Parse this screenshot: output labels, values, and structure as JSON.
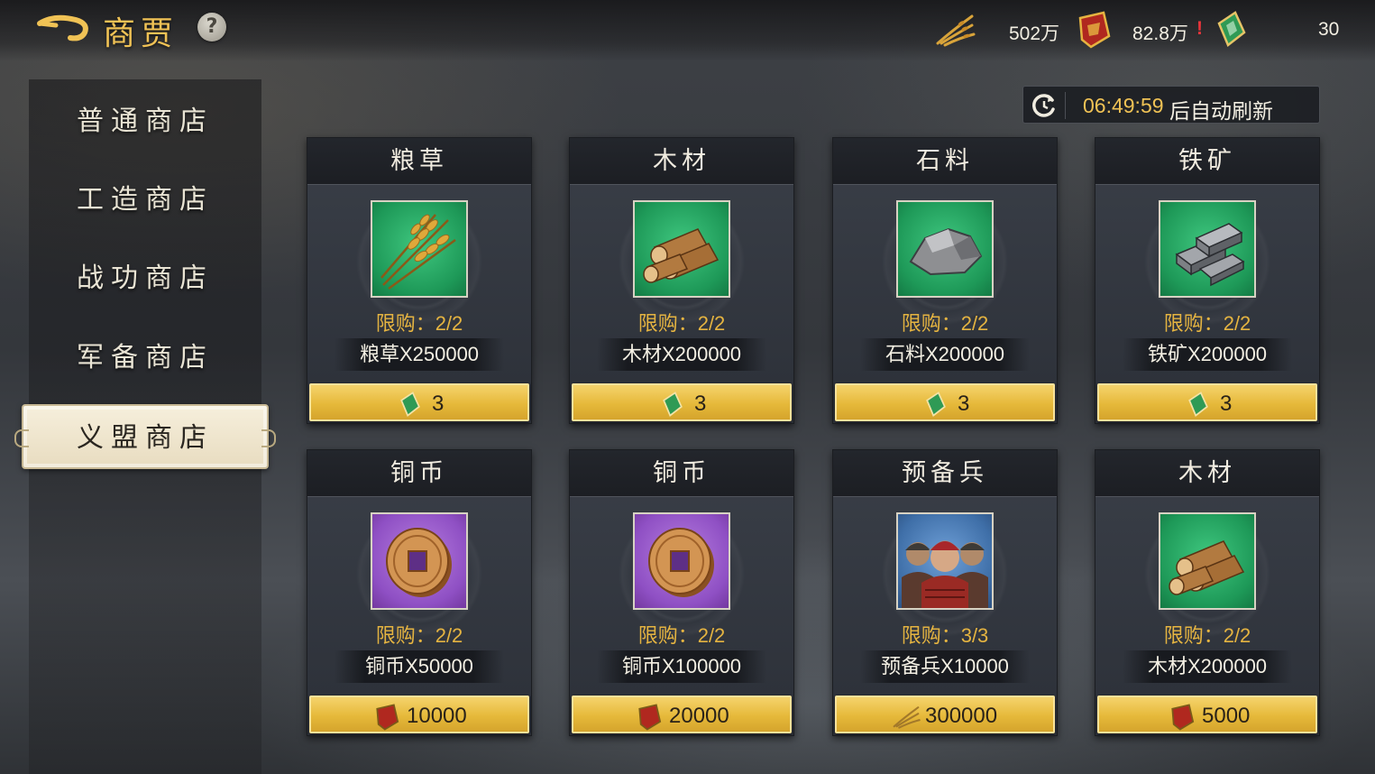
{
  "header": {
    "title": "商贾",
    "help_label": "?"
  },
  "resources": [
    {
      "name": "grain",
      "icon": "grain-icon",
      "value": "502万"
    },
    {
      "name": "merit",
      "icon": "merit-token-icon",
      "value": "82.8万",
      "warning": "!"
    },
    {
      "name": "alliance-token",
      "icon": "alliance-token-icon",
      "value": "30"
    }
  ],
  "refresh": {
    "time": "06:49:59",
    "suffix": "后自动刷新"
  },
  "sidebar": {
    "items": [
      {
        "label": "普通商店",
        "active": false
      },
      {
        "label": "工造商店",
        "active": false
      },
      {
        "label": "战功商店",
        "active": false
      },
      {
        "label": "军备商店",
        "active": false
      },
      {
        "label": "义盟商店",
        "active": true
      }
    ]
  },
  "cards": [
    {
      "title": "粮草",
      "icon": "grain-bundle-icon",
      "rarity": "green",
      "limit": "限购：2/2",
      "amount": "粮草X250000",
      "currency_icon": "alliance-token-icon",
      "price": "3"
    },
    {
      "title": "木材",
      "icon": "wood-logs-icon",
      "rarity": "green",
      "limit": "限购：2/2",
      "amount": "木材X200000",
      "currency_icon": "alliance-token-icon",
      "price": "3"
    },
    {
      "title": "石料",
      "icon": "stone-icon",
      "rarity": "green",
      "limit": "限购：2/2",
      "amount": "石料X200000",
      "currency_icon": "alliance-token-icon",
      "price": "3"
    },
    {
      "title": "铁矿",
      "icon": "iron-ingots-icon",
      "rarity": "green",
      "limit": "限购：2/2",
      "amount": "铁矿X200000",
      "currency_icon": "alliance-token-icon",
      "price": "3"
    },
    {
      "title": "铜币",
      "icon": "copper-coin-icon",
      "rarity": "purple",
      "limit": "限购：2/2",
      "amount": "铜币X50000",
      "currency_icon": "merit-token-icon",
      "price": "10000"
    },
    {
      "title": "铜币",
      "icon": "copper-coin-icon",
      "rarity": "purple",
      "limit": "限购：2/2",
      "amount": "铜币X100000",
      "currency_icon": "merit-token-icon",
      "price": "20000"
    },
    {
      "title": "预备兵",
      "icon": "reserve-soldiers-icon",
      "rarity": "blue",
      "limit": "限购：3/3",
      "amount": "预备兵X10000",
      "currency_icon": "grain-icon",
      "price": "300000"
    },
    {
      "title": "木材",
      "icon": "wood-logs-icon",
      "rarity": "green",
      "limit": "限购：2/2",
      "amount": "木材X200000",
      "currency_icon": "merit-token-icon",
      "price": "5000"
    }
  ]
}
